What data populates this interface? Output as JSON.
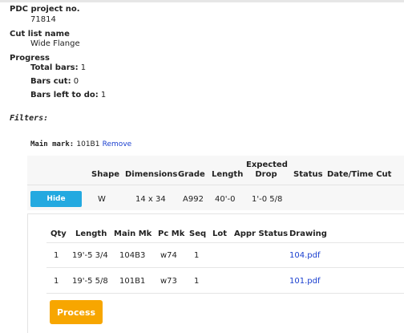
{
  "project": {
    "label": "PDC project no.",
    "value": "71814"
  },
  "cutlist": {
    "label": "Cut list name",
    "value": "Wide Flange"
  },
  "progress": {
    "label": "Progress",
    "total_label": "Total bars:",
    "total_value": "1",
    "cut_label": "Bars cut:",
    "cut_value": "0",
    "left_label": "Bars left to do:",
    "left_value": "1"
  },
  "filters": {
    "label": "Filters:",
    "main_mark_label": "Main mark:",
    "main_mark_value": "101B1",
    "remove_label": "Remove"
  },
  "main_table": {
    "headers": {
      "shape": "Shape",
      "dimensions": "Dimensions",
      "grade": "Grade",
      "length": "Length",
      "expected_drop_1": "Expected",
      "expected_drop_2": "Drop",
      "status": "Status",
      "datetime": "Date/Time Cut"
    },
    "row": {
      "button": "Hide",
      "shape": "W",
      "dimensions": "14 x 34",
      "grade": "A992",
      "length": "40'-0",
      "expected_drop": "1'-0 5/8",
      "status": "",
      "datetime": ""
    }
  },
  "sub_table": {
    "headers": {
      "qty": "Qty",
      "length": "Length",
      "main_mk": "Main Mk",
      "pc_mk": "Pc Mk",
      "seq": "Seq",
      "lot": "Lot",
      "appr_status": "Appr Status",
      "drawing": "Drawing"
    },
    "rows": [
      {
        "qty": "1",
        "length": "19'-5 3/4",
        "main_mk": "104B3",
        "pc_mk": "w74",
        "seq": "1",
        "lot": "",
        "appr_status": "",
        "drawing": "104.pdf"
      },
      {
        "qty": "1",
        "length": "19'-5 5/8",
        "main_mk": "101B1",
        "pc_mk": "w73",
        "seq": "1",
        "lot": "",
        "appr_status": "",
        "drawing": "101.pdf"
      }
    ],
    "process_button": "Process"
  }
}
